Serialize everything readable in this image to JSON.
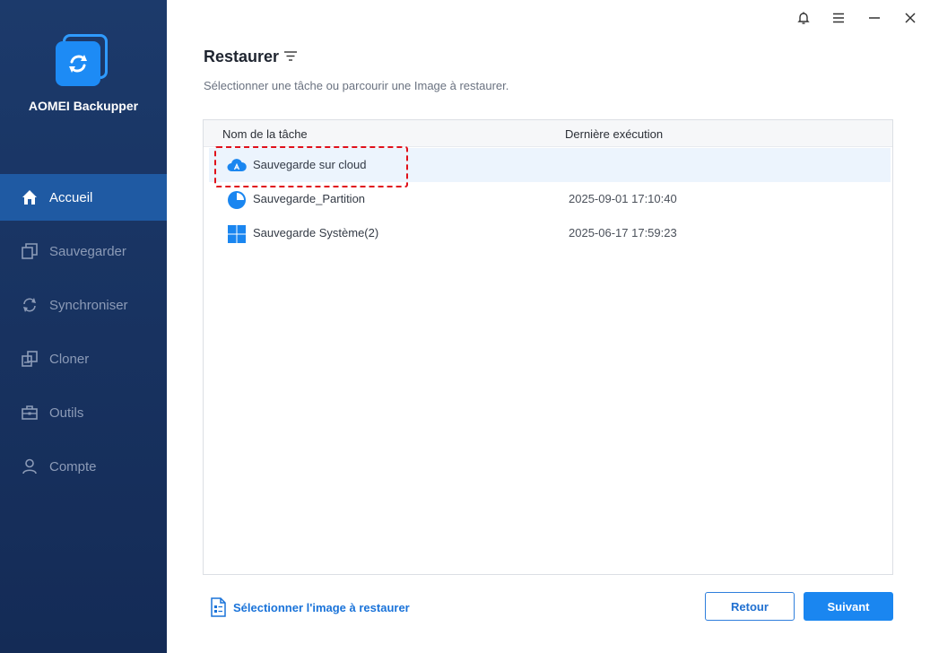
{
  "app": {
    "name": "AOMEI Backupper"
  },
  "sidebar": {
    "items": [
      {
        "label": "Accueil",
        "icon": "home-icon",
        "active": true
      },
      {
        "label": "Sauvegarder",
        "icon": "backup-icon",
        "active": false
      },
      {
        "label": "Synchroniser",
        "icon": "sync-icon",
        "active": false
      },
      {
        "label": "Cloner",
        "icon": "clone-icon",
        "active": false
      },
      {
        "label": "Outils",
        "icon": "toolbox-icon",
        "active": false
      },
      {
        "label": "Compte",
        "icon": "user-icon",
        "active": false
      }
    ]
  },
  "window_controls": [
    "bell-icon",
    "menu-icon",
    "minimize-icon",
    "close-icon"
  ],
  "main": {
    "title": "Restaurer",
    "subtitle": "Sélectionner une tâche ou parcourir une Image à restaurer.",
    "table": {
      "columns": [
        "Nom de la tâche",
        "Dernière exécution"
      ],
      "rows": [
        {
          "name": "Sauvegarde sur cloud",
          "last_run": "",
          "icon": "cloud-icon",
          "selected": true
        },
        {
          "name": "Sauvegarde_Partition",
          "last_run": "2025-09-01 17:10:40",
          "icon": "partition-pie-icon",
          "selected": false
        },
        {
          "name": "Sauvegarde Système(2)",
          "last_run": "2025-06-17 17:59:23",
          "icon": "windows-icon",
          "selected": false
        }
      ]
    }
  },
  "footer": {
    "select_image_label": "Sélectionner l'image à restaurer",
    "back_label": "Retour",
    "next_label": "Suivant"
  },
  "colors": {
    "sidebar_bg": "#1c3a6b",
    "sidebar_active": "#1f5aa3",
    "accent": "#1a86f0",
    "highlight_border": "#e0101a"
  }
}
